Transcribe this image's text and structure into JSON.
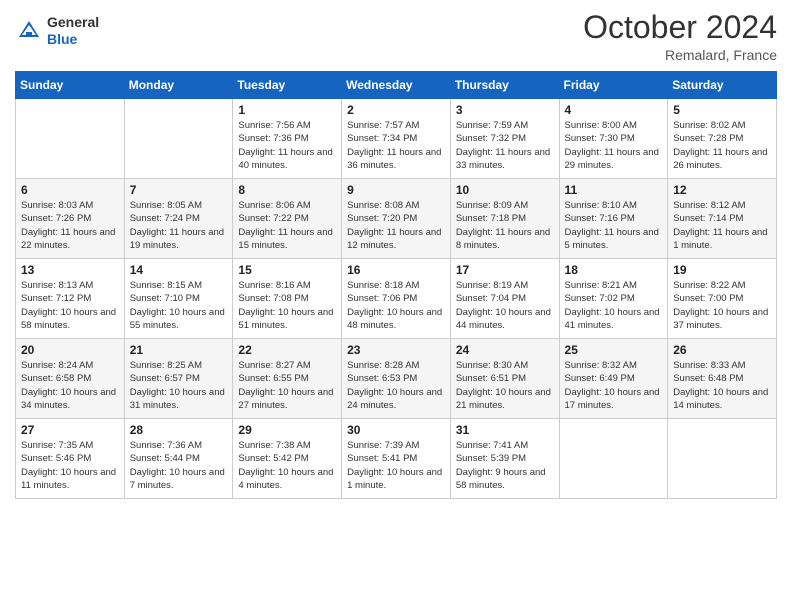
{
  "header": {
    "logo_line1": "General",
    "logo_line2": "Blue",
    "title": "October 2024",
    "location": "Remalard, France"
  },
  "weekdays": [
    "Sunday",
    "Monday",
    "Tuesday",
    "Wednesday",
    "Thursday",
    "Friday",
    "Saturday"
  ],
  "weeks": [
    [
      {
        "day": "",
        "info": ""
      },
      {
        "day": "",
        "info": ""
      },
      {
        "day": "1",
        "info": "Sunrise: 7:56 AM\nSunset: 7:36 PM\nDaylight: 11 hours and 40 minutes."
      },
      {
        "day": "2",
        "info": "Sunrise: 7:57 AM\nSunset: 7:34 PM\nDaylight: 11 hours and 36 minutes."
      },
      {
        "day": "3",
        "info": "Sunrise: 7:59 AM\nSunset: 7:32 PM\nDaylight: 11 hours and 33 minutes."
      },
      {
        "day": "4",
        "info": "Sunrise: 8:00 AM\nSunset: 7:30 PM\nDaylight: 11 hours and 29 minutes."
      },
      {
        "day": "5",
        "info": "Sunrise: 8:02 AM\nSunset: 7:28 PM\nDaylight: 11 hours and 26 minutes."
      }
    ],
    [
      {
        "day": "6",
        "info": "Sunrise: 8:03 AM\nSunset: 7:26 PM\nDaylight: 11 hours and 22 minutes."
      },
      {
        "day": "7",
        "info": "Sunrise: 8:05 AM\nSunset: 7:24 PM\nDaylight: 11 hours and 19 minutes."
      },
      {
        "day": "8",
        "info": "Sunrise: 8:06 AM\nSunset: 7:22 PM\nDaylight: 11 hours and 15 minutes."
      },
      {
        "day": "9",
        "info": "Sunrise: 8:08 AM\nSunset: 7:20 PM\nDaylight: 11 hours and 12 minutes."
      },
      {
        "day": "10",
        "info": "Sunrise: 8:09 AM\nSunset: 7:18 PM\nDaylight: 11 hours and 8 minutes."
      },
      {
        "day": "11",
        "info": "Sunrise: 8:10 AM\nSunset: 7:16 PM\nDaylight: 11 hours and 5 minutes."
      },
      {
        "day": "12",
        "info": "Sunrise: 8:12 AM\nSunset: 7:14 PM\nDaylight: 11 hours and 1 minute."
      }
    ],
    [
      {
        "day": "13",
        "info": "Sunrise: 8:13 AM\nSunset: 7:12 PM\nDaylight: 10 hours and 58 minutes."
      },
      {
        "day": "14",
        "info": "Sunrise: 8:15 AM\nSunset: 7:10 PM\nDaylight: 10 hours and 55 minutes."
      },
      {
        "day": "15",
        "info": "Sunrise: 8:16 AM\nSunset: 7:08 PM\nDaylight: 10 hours and 51 minutes."
      },
      {
        "day": "16",
        "info": "Sunrise: 8:18 AM\nSunset: 7:06 PM\nDaylight: 10 hours and 48 minutes."
      },
      {
        "day": "17",
        "info": "Sunrise: 8:19 AM\nSunset: 7:04 PM\nDaylight: 10 hours and 44 minutes."
      },
      {
        "day": "18",
        "info": "Sunrise: 8:21 AM\nSunset: 7:02 PM\nDaylight: 10 hours and 41 minutes."
      },
      {
        "day": "19",
        "info": "Sunrise: 8:22 AM\nSunset: 7:00 PM\nDaylight: 10 hours and 37 minutes."
      }
    ],
    [
      {
        "day": "20",
        "info": "Sunrise: 8:24 AM\nSunset: 6:58 PM\nDaylight: 10 hours and 34 minutes."
      },
      {
        "day": "21",
        "info": "Sunrise: 8:25 AM\nSunset: 6:57 PM\nDaylight: 10 hours and 31 minutes."
      },
      {
        "day": "22",
        "info": "Sunrise: 8:27 AM\nSunset: 6:55 PM\nDaylight: 10 hours and 27 minutes."
      },
      {
        "day": "23",
        "info": "Sunrise: 8:28 AM\nSunset: 6:53 PM\nDaylight: 10 hours and 24 minutes."
      },
      {
        "day": "24",
        "info": "Sunrise: 8:30 AM\nSunset: 6:51 PM\nDaylight: 10 hours and 21 minutes."
      },
      {
        "day": "25",
        "info": "Sunrise: 8:32 AM\nSunset: 6:49 PM\nDaylight: 10 hours and 17 minutes."
      },
      {
        "day": "26",
        "info": "Sunrise: 8:33 AM\nSunset: 6:48 PM\nDaylight: 10 hours and 14 minutes."
      }
    ],
    [
      {
        "day": "27",
        "info": "Sunrise: 7:35 AM\nSunset: 5:46 PM\nDaylight: 10 hours and 11 minutes."
      },
      {
        "day": "28",
        "info": "Sunrise: 7:36 AM\nSunset: 5:44 PM\nDaylight: 10 hours and 7 minutes."
      },
      {
        "day": "29",
        "info": "Sunrise: 7:38 AM\nSunset: 5:42 PM\nDaylight: 10 hours and 4 minutes."
      },
      {
        "day": "30",
        "info": "Sunrise: 7:39 AM\nSunset: 5:41 PM\nDaylight: 10 hours and 1 minute."
      },
      {
        "day": "31",
        "info": "Sunrise: 7:41 AM\nSunset: 5:39 PM\nDaylight: 9 hours and 58 minutes."
      },
      {
        "day": "",
        "info": ""
      },
      {
        "day": "",
        "info": ""
      }
    ]
  ]
}
